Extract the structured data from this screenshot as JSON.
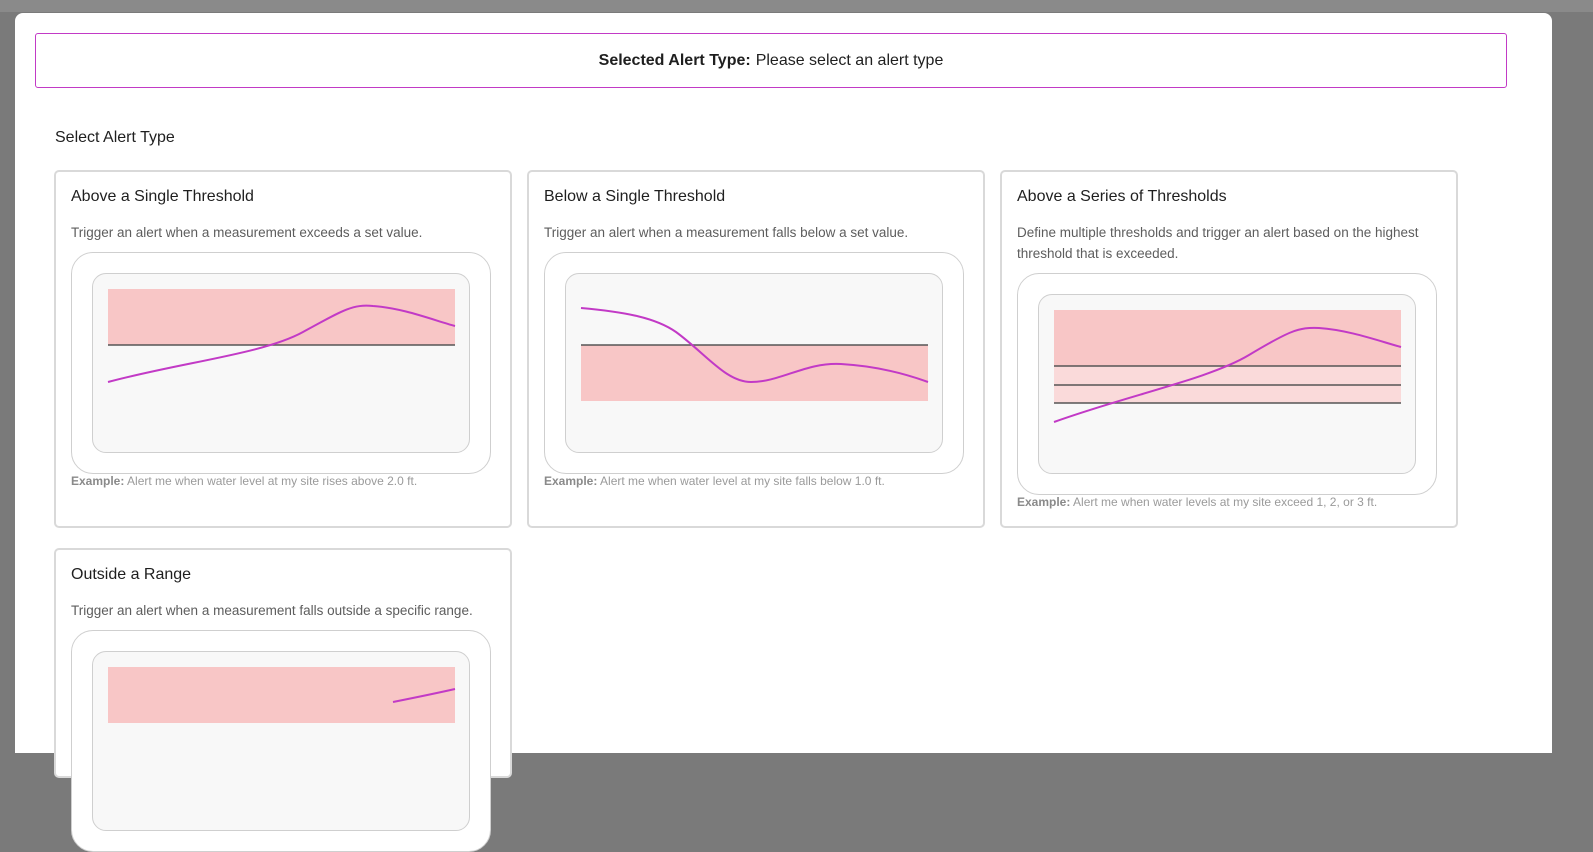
{
  "banner": {
    "label": "Selected Alert Type:",
    "value": "Please select an alert type"
  },
  "section_title": "Select Alert Type",
  "example_label": "Example:",
  "colors": {
    "accent": "#c23ac6",
    "zone": "#f8c6c6",
    "zone_light": "#fadada",
    "threshold_line": "#555555"
  },
  "cards": [
    {
      "title": "Above a Single Threshold",
      "description": "Trigger an alert when a measurement exceeds a set value.",
      "example": "Alert me when water level at my site rises above 2.0 ft."
    },
    {
      "title": "Below a Single Threshold",
      "description": "Trigger an alert when a measurement falls below a set value.",
      "example": "Alert me when water level at my site falls below 1.0 ft."
    },
    {
      "title": "Above a Series of Thresholds",
      "description": "Define multiple thresholds and trigger an alert based on the highest threshold that is exceeded.",
      "example": "Alert me when water levels at my site exceed 1, 2, or 3 ft."
    },
    {
      "title": "Outside a Range",
      "description": "Trigger an alert when a measurement falls outside a specific range.",
      "example": ""
    }
  ]
}
